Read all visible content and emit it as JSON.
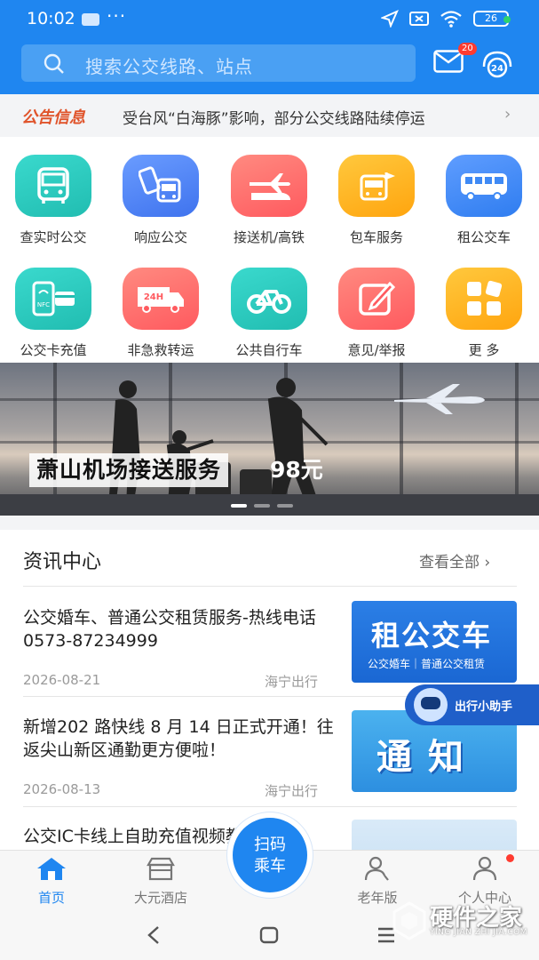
{
  "status": {
    "time": "10:02",
    "dots": "···",
    "battery": "26"
  },
  "search": {
    "placeholder": "搜索公交线路、站点"
  },
  "header": {
    "mail_badge": "20"
  },
  "notice": {
    "tag": "公告信息",
    "text": "受台风“白海豚”影响，部分公交线路陆续停运",
    "chevron": "›"
  },
  "grid": {
    "items": [
      {
        "label": "查实时公交",
        "icon": "bus-icon",
        "color": "#2fcfc3"
      },
      {
        "label": "响应公交",
        "icon": "phone-bus-icon",
        "color": "#4f86f7"
      },
      {
        "label": "接送机/高铁",
        "icon": "plane-train-icon",
        "color": "#ff6f6a"
      },
      {
        "label": "包车服务",
        "icon": "charter-icon",
        "color": "#ffb21c"
      },
      {
        "label": "租公交车",
        "icon": "coach-icon",
        "color": "#3f8af5"
      },
      {
        "label": "公交卡充值",
        "icon": "nfc-card-icon",
        "color": "#2fcfc3"
      },
      {
        "label": "非急救转运",
        "icon": "ambulance-icon",
        "color": "#ff6f6a"
      },
      {
        "label": "公共自行车",
        "icon": "bicycle-icon",
        "color": "#2fcfc3"
      },
      {
        "label": "意见/举报",
        "icon": "edit-icon",
        "color": "#ff6f6a"
      },
      {
        "label": "更  多",
        "icon": "more-apps-icon",
        "color": "#ffb21c"
      }
    ]
  },
  "banner": {
    "title": "萧山机场接送服务",
    "price": "98元"
  },
  "news": {
    "heading": "资讯中心",
    "more": "查看全部 ›",
    "items": [
      {
        "title": "公交婚车、普通公交租赁服务-热线电话0573-87234999",
        "date": "2026-08-21",
        "source": "海宁出行",
        "thumb_big": "租公交车",
        "thumb_small": "公交婚车｜普通公交租赁"
      },
      {
        "title": "新增202 路快线 8 月 14 日正式开通！往返尖山新区通勤更方便啦！",
        "date": "2026-08-13",
        "source": "海宁出行",
        "thumb_big": "通知"
      },
      {
        "title": "公交IC卡线上自助充值视频教程"
      }
    ]
  },
  "assistant": {
    "label": "出行小助手"
  },
  "tabs": [
    {
      "label": "首页",
      "icon": "home-icon",
      "active": true
    },
    {
      "label": "大元酒店",
      "icon": "hotel-icon"
    },
    {
      "label": "老年版",
      "icon": "elder-icon"
    },
    {
      "label": "个人中心",
      "icon": "user-icon"
    }
  ],
  "scan": {
    "line1": "扫码",
    "line2": "乘车"
  },
  "watermark": {
    "zh": "硬件之家",
    "en": "YING JIAN ZHI JIA.COM"
  },
  "colors": {
    "primary": "#1f86f0",
    "notice_tag": "#e0542b"
  }
}
